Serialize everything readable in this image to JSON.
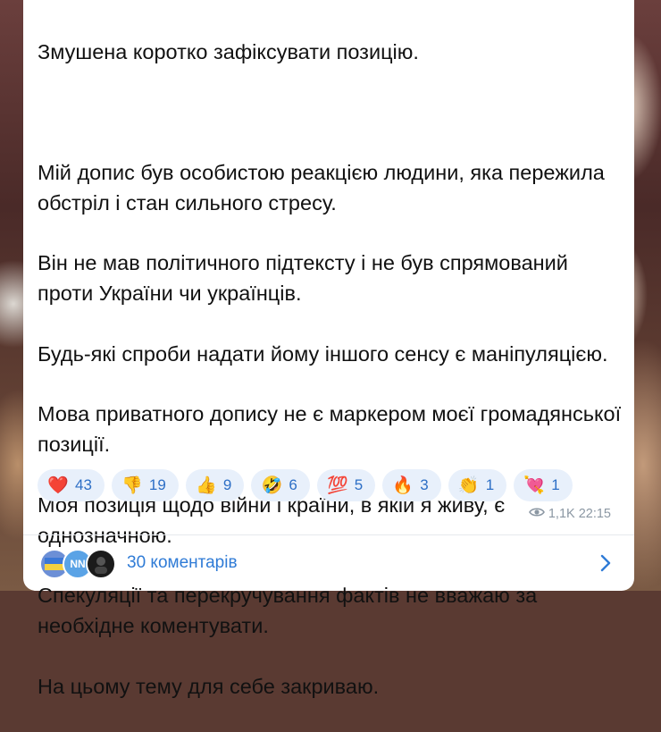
{
  "message": {
    "paragraphs": [
      "Змушена коротко зафіксувати позицію.",
      "",
      "Мій допис був особистою реакцією людини, яка пережила обстріл і стан сильного стресу.",
      "Він не мав політичного підтексту і не був спрямований проти України чи українців.",
      "Будь-які спроби надати йому іншого сенсу є маніпуляцією.",
      "Мова приватного допису не є маркером моєї громадянської позиції.",
      "Моя позиція щодо війни і країни, в якій я живу, є однозначною.",
      "Спекуляції та перекручування фактів не вважаю за необхідне коментувати.",
      "На цьому тему для себе закриваю."
    ]
  },
  "reactions": [
    {
      "emoji": "❤️",
      "icon": "heart-icon",
      "count": "43"
    },
    {
      "emoji": "👎",
      "icon": "thumbs-down-icon",
      "count": "19"
    },
    {
      "emoji": "👍",
      "icon": "thumbs-up-icon",
      "count": "9"
    },
    {
      "emoji": "🤣",
      "icon": "rofl-icon",
      "count": "6"
    },
    {
      "emoji": "💯",
      "icon": "hundred-icon",
      "count": "5"
    },
    {
      "emoji": "🔥",
      "icon": "fire-icon",
      "count": "3"
    },
    {
      "emoji": "👏",
      "icon": "clap-icon",
      "count": "1"
    },
    {
      "emoji": "💘",
      "icon": "heart-arrow-icon",
      "count": "1"
    }
  ],
  "meta": {
    "views": "1,1K",
    "time": "22:15"
  },
  "comments": {
    "label": "30 коментарів",
    "avatars": [
      "",
      "NN",
      ""
    ]
  },
  "colors": {
    "accent": "#2f7bd6",
    "reaction_bg": "#e8f0fb",
    "meta_text": "#8b97a3"
  }
}
